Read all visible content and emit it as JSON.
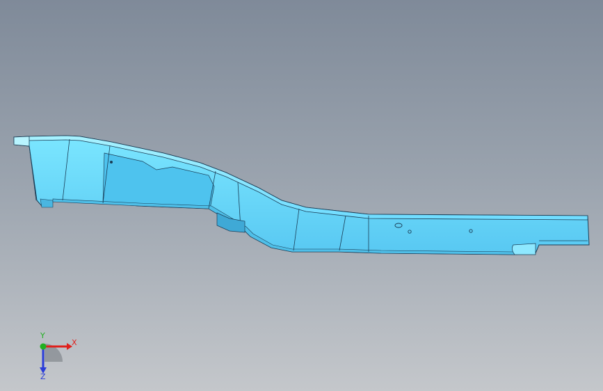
{
  "viewport": {
    "background_top": "#7f8a99",
    "background_bottom": "#c4c7cb",
    "model_color": "#6fdcff",
    "model_edge_color": "#1a3c55"
  },
  "triad": {
    "x_label": "X",
    "y_label": "Y",
    "z_label": "Z",
    "x_color": "#e0201c",
    "y_color": "#20b020",
    "z_color": "#2a3cd8"
  }
}
